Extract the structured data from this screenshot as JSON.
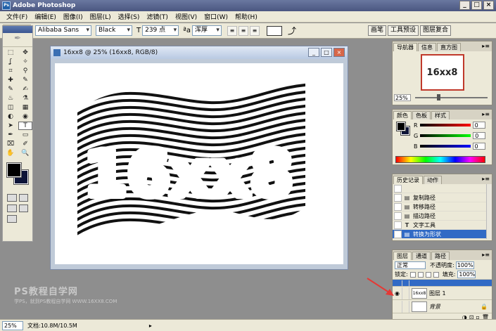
{
  "app": {
    "title": "Adobe Photoshop",
    "logo": "Ps"
  },
  "window_controls": {
    "minimize": "_",
    "maximize": "□",
    "close": "×"
  },
  "menu": [
    "文件(F)",
    "编辑(E)",
    "图像(I)",
    "图层(L)",
    "选择(S)",
    "滤镜(T)",
    "视图(V)",
    "窗口(W)",
    "帮助(H)"
  ],
  "options": {
    "tool_glyph": "T",
    "font_family": "Alibaba Sans",
    "font_style": "Black",
    "size_icon": "T",
    "font_size": "239 点",
    "aa_icon": "ªa",
    "antialias": "浑厚",
    "align_left": "≡",
    "align_center": "≡",
    "align_right": "≡",
    "warp_icon": "⤴",
    "palette_tabs": [
      "画笔",
      "工具预设",
      "图层复合"
    ]
  },
  "toolbox": {
    "feather": "✒",
    "tools": [
      "⬚",
      "✥",
      "ʆ",
      "✧",
      "⌗",
      "⚲",
      "✚",
      "✎",
      "✎",
      "✍",
      "♨",
      "⚗",
      "◫",
      "▦",
      "◐",
      "◉",
      "➤",
      "T",
      "✒",
      "▭",
      "⌧",
      "✐",
      "✋",
      "🔍"
    ]
  },
  "document": {
    "title": "16xx8 @ 25% (16xx8, RGB/8)",
    "art_text": "16xx8",
    "minimize": "_",
    "maximize": "□",
    "close": "×"
  },
  "navigator": {
    "tabs": [
      "导航器",
      "信息",
      "直方图"
    ],
    "thumb_text": "16xx8",
    "zoom": "25%"
  },
  "color": {
    "tabs": [
      "颜色",
      "色板",
      "样式"
    ],
    "rows": [
      {
        "label": "R",
        "value": "0",
        "gradient": "linear-gradient(90deg,#000,#f00)"
      },
      {
        "label": "G",
        "value": "0",
        "gradient": "linear-gradient(90deg,#000,#0f0)"
      },
      {
        "label": "B",
        "value": "0",
        "gradient": "linear-gradient(90deg,#000,#00f)"
      }
    ]
  },
  "history": {
    "tabs": [
      "历史记录",
      "动作"
    ],
    "items": [
      {
        "label": "",
        "icon": ""
      },
      {
        "label": "复制路径",
        "icon": "▤"
      },
      {
        "label": "转移路径",
        "icon": "▤"
      },
      {
        "label": "描边路径",
        "icon": "▤"
      },
      {
        "label": "文字工具",
        "icon": "T"
      },
      {
        "label": "转换为形状",
        "icon": "▤",
        "selected": true
      }
    ]
  },
  "layers": {
    "tabs": [
      "图层",
      "通道",
      "路径"
    ],
    "blend_mode": "正常",
    "opacity_label": "不透明度:",
    "opacity": "100%",
    "lock_label": "锁定:",
    "fill_label": "填充:",
    "fill": "100%",
    "rows": [
      {
        "name": "",
        "selected": true,
        "eye": ""
      },
      {
        "name": "图层 1",
        "selected": false,
        "eye": "◉"
      },
      {
        "name": "背景",
        "selected": false,
        "eye": "",
        "lock": "🔒"
      }
    ]
  },
  "watermark": {
    "line1": "PS教程自学网",
    "line2": "学PS，就到PS教程自学网 WWW.16XX8.COM"
  },
  "status": {
    "zoom": "25%",
    "doc": "文档:10.8M/10.5M",
    "arrow": "▸"
  },
  "panel_menu": "▸≡",
  "footer_icons": [
    "⊡",
    "◑",
    "▫",
    "🗑"
  ],
  "colors": {
    "selection": "#316ac5",
    "highlight_border": "#c0392b",
    "arrow": "#e53935"
  }
}
